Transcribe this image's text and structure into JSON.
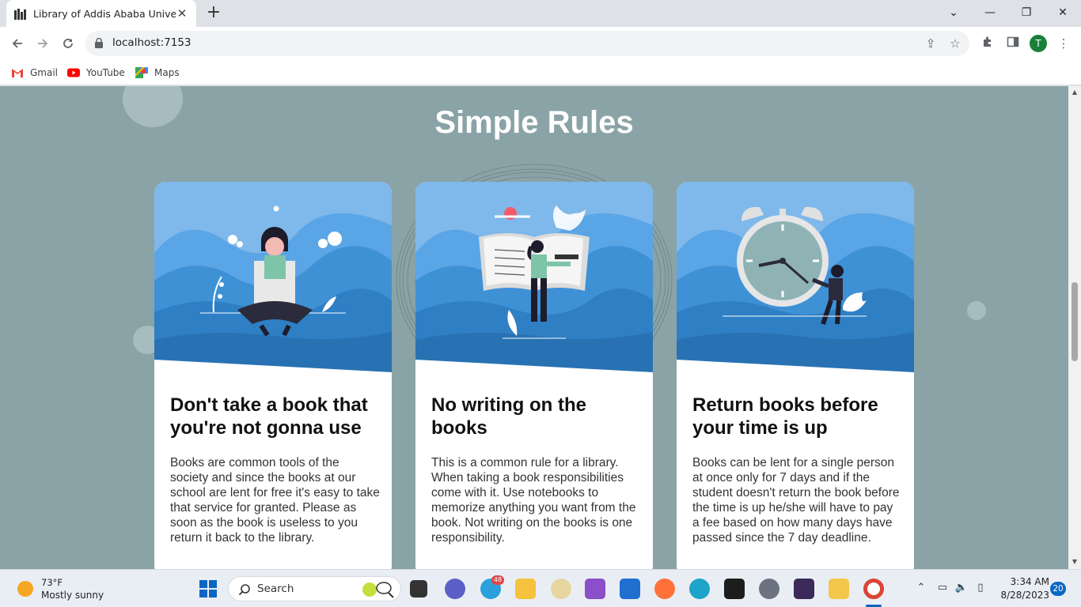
{
  "browser": {
    "tab_title": "Library of Addis Ababa University",
    "tab_close": "✕",
    "new_tab": "+",
    "url": "localhost:7153",
    "avatar_letter": "T",
    "window_controls": {
      "minimize": "—",
      "restore": "❐",
      "close": "✕",
      "tab_search": "⌄"
    },
    "bookmarks": [
      {
        "label": "Gmail",
        "icon": "gmail-icon"
      },
      {
        "label": "YouTube",
        "icon": "youtube-icon"
      },
      {
        "label": "Maps",
        "icon": "maps-icon"
      }
    ]
  },
  "page": {
    "section_title": "Simple Rules",
    "background_color": "#8aa3a6",
    "cards": [
      {
        "title": "Don't take a book that you're not gonna use",
        "text": "Books are common tools of the society and since the books at our school are lent for free it's easy to take that service for granted. Please as soon as the book is useless to you return it back to the library.",
        "illustration": "woman-reading-illustration"
      },
      {
        "title": "No writing on the books",
        "text": "This is a common rule for a library. When taking a book responsibilities come with it. Use notebooks to memorize anything you want from the book. Not writing on the books is one responsibility.",
        "illustration": "woman-with-giant-book-illustration"
      },
      {
        "title": "Return books before your time is up",
        "text": "Books can be lent for a single person at once only for 7 days and if the student doesn't return the book before the time is up he/she will have to pay a fee based on how many days have passed since the 7 day deadline.",
        "illustration": "woman-with-alarm-clock-illustration"
      }
    ]
  },
  "taskbar": {
    "weather_temp": "73°F",
    "weather_desc": "Mostly sunny",
    "search_label": "Search",
    "telegram_badge": "48",
    "time": "3:34 AM",
    "date": "8/28/2023",
    "notification_count": "20"
  }
}
